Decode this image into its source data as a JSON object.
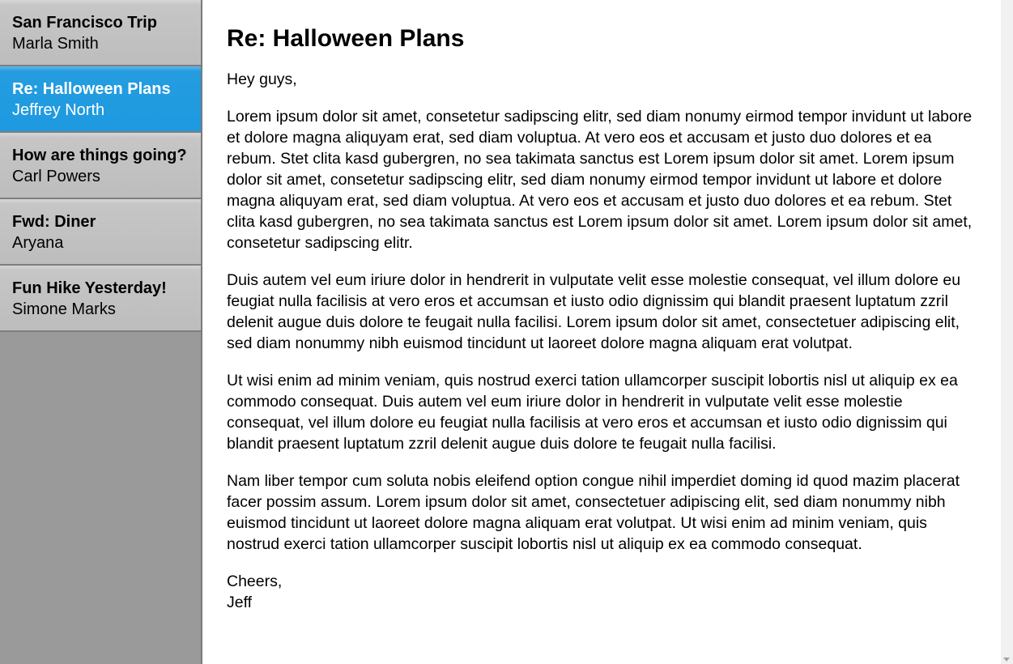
{
  "inbox": {
    "items": [
      {
        "subject": "San Francisco Trip",
        "sender": "Marla Smith"
      },
      {
        "subject": "Re: Halloween Plans",
        "sender": "Jeffrey North"
      },
      {
        "subject": "How are things going?",
        "sender": "Carl Powers"
      },
      {
        "subject": "Fwd: Diner",
        "sender": "Aryana"
      },
      {
        "subject": "Fun Hike Yesterday!",
        "sender": "Simone Marks"
      }
    ],
    "selected_index": 1
  },
  "email": {
    "title": "Re: Halloween Plans",
    "greeting": "Hey guys,",
    "paragraphs": [
      "Lorem ipsum dolor sit amet, consetetur sadipscing elitr, sed diam nonumy eirmod tempor invidunt ut labore et dolore magna aliquyam erat, sed diam voluptua. At vero eos et accusam et justo duo dolores et ea rebum. Stet clita kasd gubergren, no sea takimata sanctus est Lorem ipsum dolor sit amet. Lorem ipsum dolor sit amet, consetetur sadipscing elitr, sed diam nonumy eirmod tempor invidunt ut labore et dolore magna aliquyam erat, sed diam voluptua. At vero eos et accusam et justo duo dolores et ea rebum. Stet clita kasd gubergren, no sea takimata sanctus est Lorem ipsum dolor sit amet. Lorem ipsum dolor sit amet, consetetur sadipscing elitr.",
      "Duis autem vel eum iriure dolor in hendrerit in vulputate velit esse molestie consequat, vel illum dolore eu feugiat nulla facilisis at vero eros et accumsan et iusto odio dignissim qui blandit praesent luptatum zzril delenit augue duis dolore te feugait nulla facilisi. Lorem ipsum dolor sit amet, consectetuer adipiscing elit, sed diam nonummy nibh euismod tincidunt ut laoreet dolore magna aliquam erat volutpat.",
      "Ut wisi enim ad minim veniam, quis nostrud exerci tation ullamcorper suscipit lobortis nisl ut aliquip ex ea commodo consequat. Duis autem vel eum iriure dolor in hendrerit in vulputate velit esse molestie consequat, vel illum dolore eu feugiat nulla facilisis at vero eros et accumsan et iusto odio dignissim qui blandit praesent luptatum zzril delenit augue duis dolore te feugait nulla facilisi.",
      "Nam liber tempor cum soluta nobis eleifend option congue nihil imperdiet doming id quod mazim placerat facer possim assum. Lorem ipsum dolor sit amet, consectetuer adipiscing elit, sed diam nonummy nibh euismod tincidunt ut laoreet dolore magna aliquam erat volutpat. Ut wisi enim ad minim veniam, quis nostrud exerci tation ullamcorper suscipit lobortis nisl ut aliquip ex ea commodo consequat."
    ],
    "closing": "Cheers,",
    "signature": "Jeff"
  },
  "colors": {
    "selected_bg": "#1e9ae0",
    "item_bg": "#bdbdbd",
    "sidebar_bg": "#9a9a9a"
  }
}
